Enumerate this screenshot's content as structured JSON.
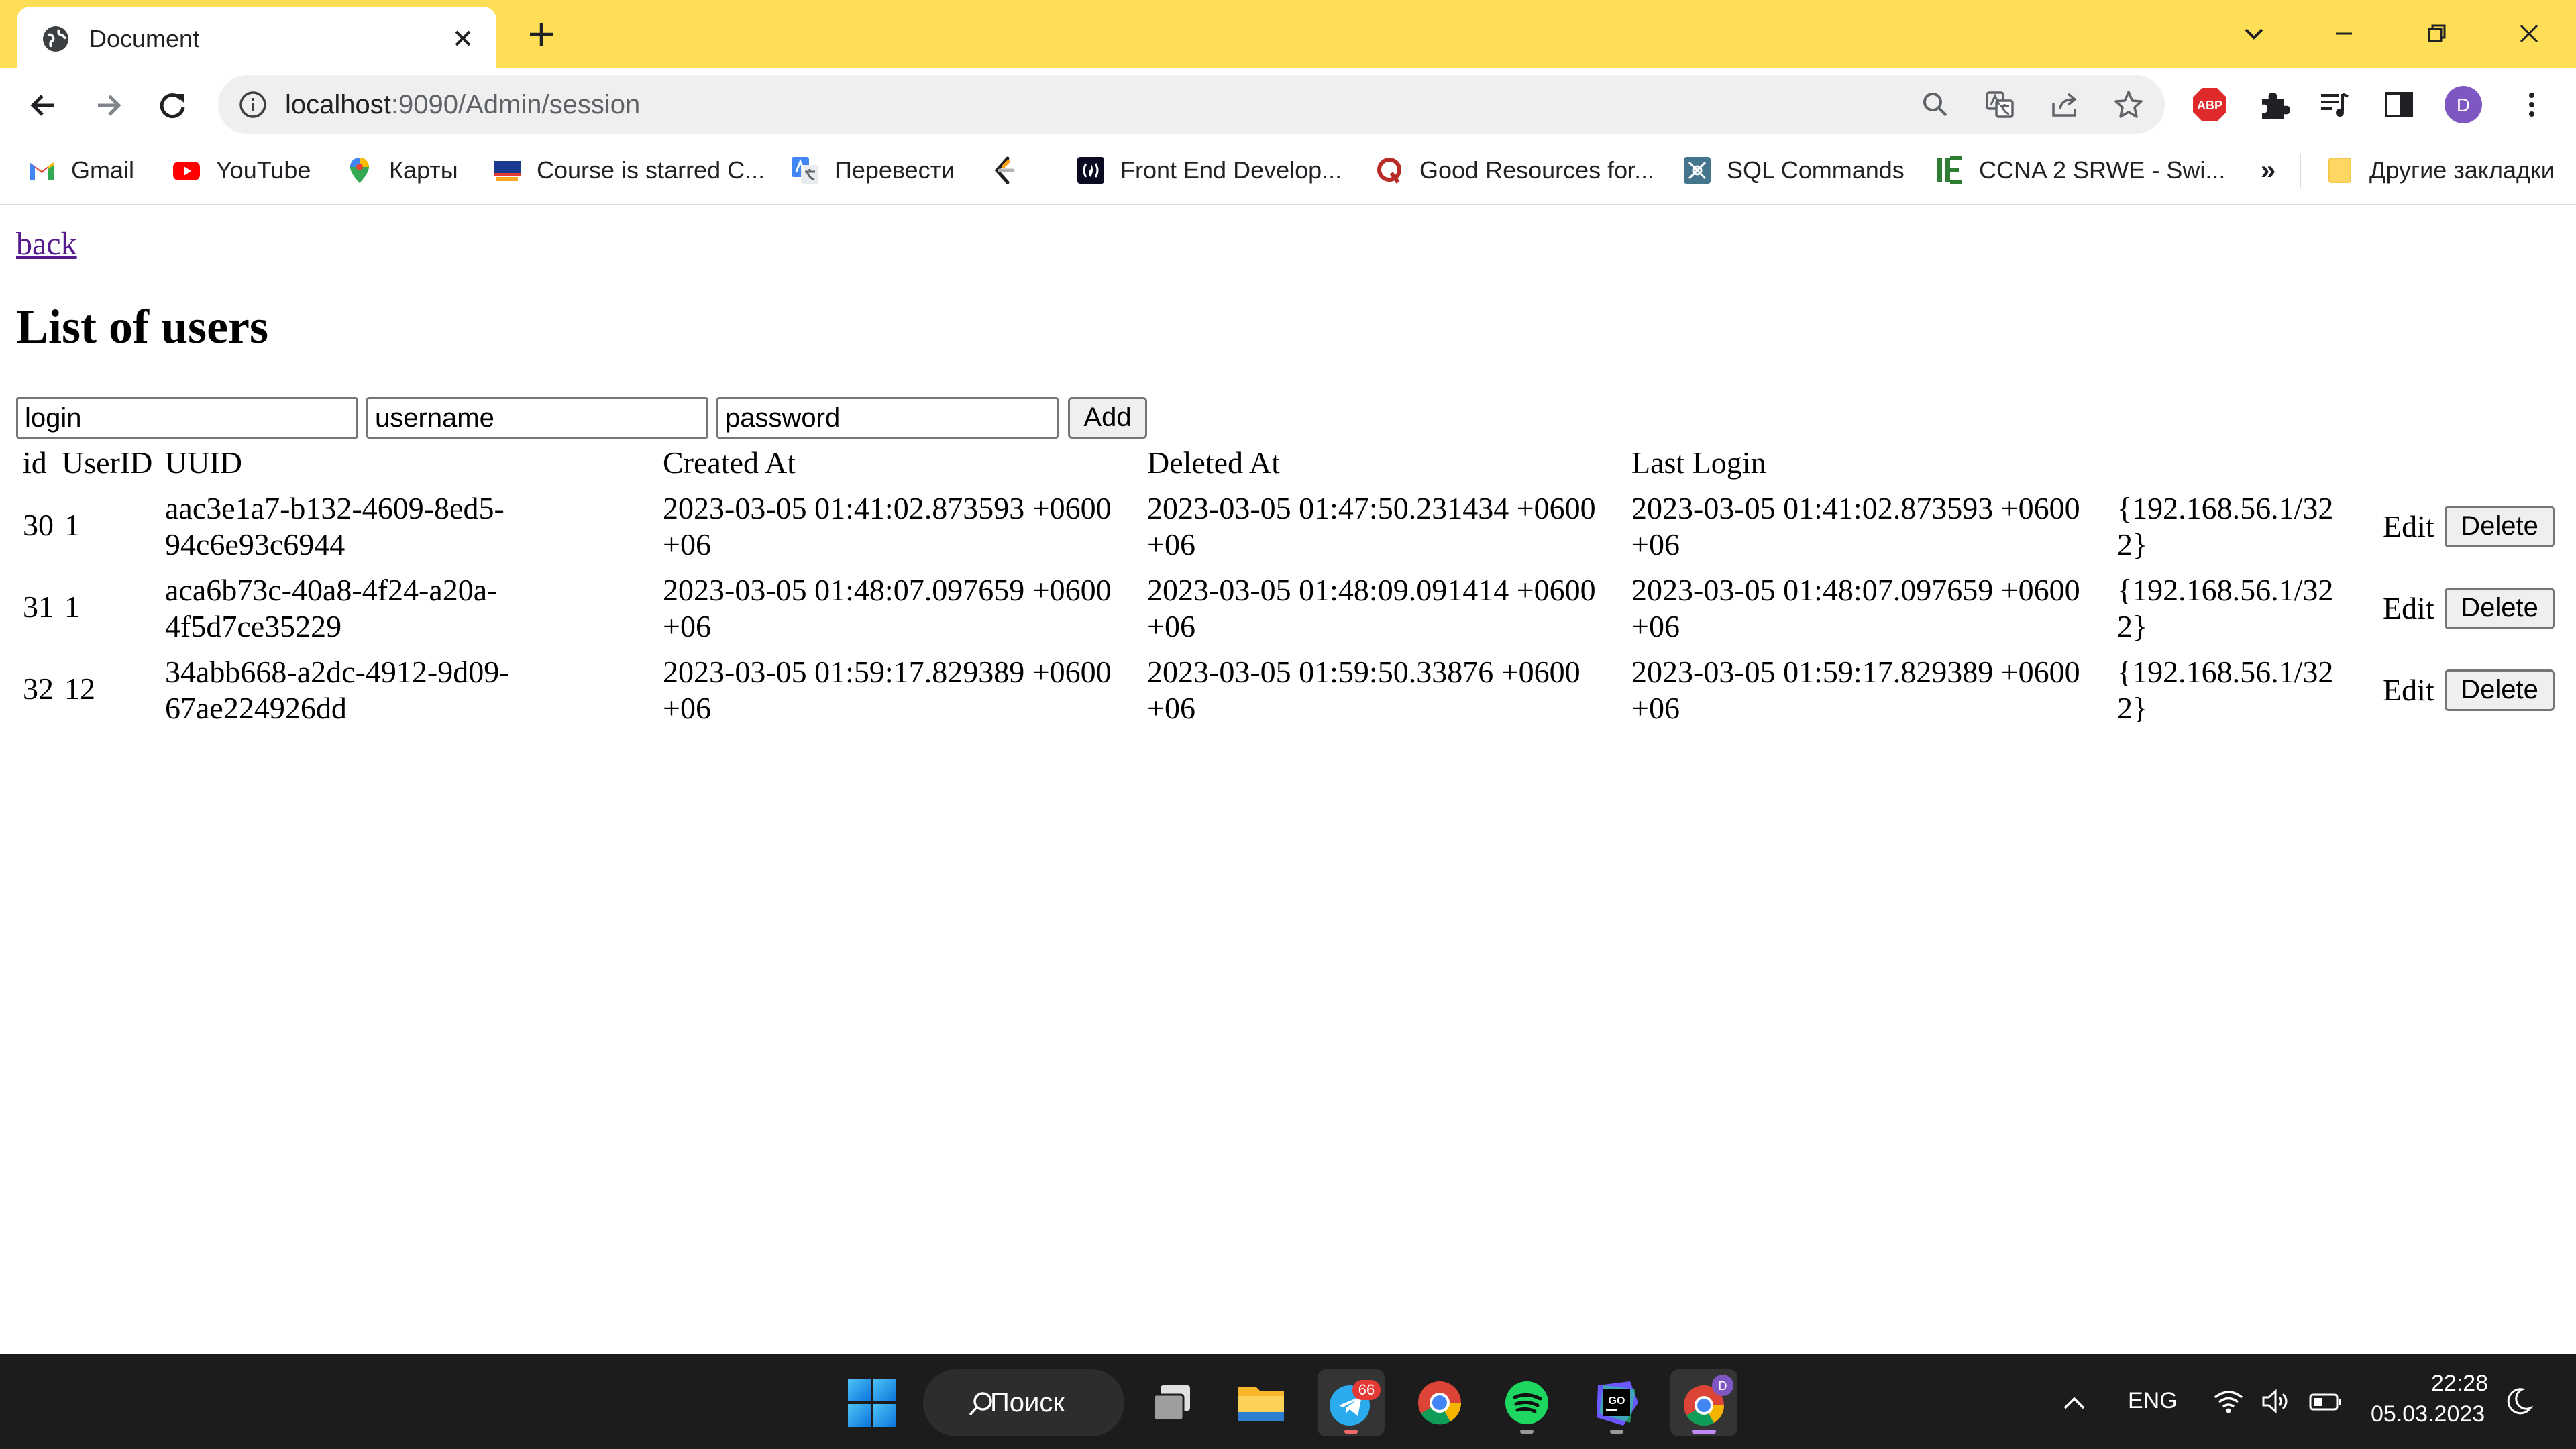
{
  "browser": {
    "tab_title": "Document",
    "url_host": "localhost",
    "url_rest": ":9090/Admin/session",
    "profile_initial": "D",
    "abp_label": "ABP",
    "bookmarks": [
      {
        "label": "Gmail",
        "icon": "gmail-icon"
      },
      {
        "label": "YouTube",
        "icon": "youtube-icon"
      },
      {
        "label": "Карты",
        "icon": "maps-icon"
      },
      {
        "label": "Course is starred C...",
        "icon": "sdu-icon"
      },
      {
        "label": "Перевести",
        "icon": "translate-icon"
      },
      {
        "label": "",
        "icon": "leetcode-icon"
      },
      {
        "label": "Front End Develop...",
        "icon": "frontend-icon"
      },
      {
        "label": "Good Resources for...",
        "icon": "quora-icon"
      },
      {
        "label": "SQL Commands",
        "icon": "sql-icon"
      },
      {
        "label": "CCNA 2 SRWE - Swi...",
        "icon": "ccna-icon"
      }
    ],
    "more_bookmarks": "»",
    "other_bookmarks": "Другие закладки"
  },
  "page": {
    "back_link": "back",
    "title": "List of users",
    "form": {
      "login_placeholder": "login",
      "username_placeholder": "username",
      "password_placeholder": "password",
      "add_label": "Add"
    },
    "table": {
      "headers": [
        "id",
        "UserID",
        "UUID",
        "Created At",
        "Deleted At",
        "Last Login"
      ],
      "rows": [
        {
          "id": "30",
          "user_id": "1",
          "uuid_1": "aac3e1a7-b132-4609-8ed5-",
          "uuid_2": "94c6e93c6944",
          "created_1": "2023-03-05 01:41:02.873593 +0600",
          "created_2": "+06",
          "deleted_1": "2023-03-05 01:47:50.231434 +0600",
          "deleted_2": "+06",
          "login_1": "2023-03-05 01:41:02.873593 +0600",
          "login_2": "+06",
          "ip_1": "{192.168.56.1/32",
          "ip_2": "2}",
          "edit": "Edit",
          "delete": "Delete"
        },
        {
          "id": "31",
          "user_id": "1",
          "uuid_1": "aca6b73c-40a8-4f24-a20a-",
          "uuid_2": "4f5d7ce35229",
          "created_1": "2023-03-05 01:48:07.097659 +0600",
          "created_2": "+06",
          "deleted_1": "2023-03-05 01:48:09.091414 +0600",
          "deleted_2": "+06",
          "login_1": "2023-03-05 01:48:07.097659 +0600",
          "login_2": "+06",
          "ip_1": "{192.168.56.1/32",
          "ip_2": "2}",
          "edit": "Edit",
          "delete": "Delete"
        },
        {
          "id": "32",
          "user_id": "12",
          "uuid_1": "34abb668-a2dc-4912-9d09-",
          "uuid_2": "67ae224926dd",
          "created_1": "2023-03-05 01:59:17.829389 +0600",
          "created_2": "+06",
          "deleted_1": "2023-03-05 01:59:50.33876 +0600",
          "deleted_2": "+06",
          "login_1": "2023-03-05 01:59:17.829389 +0600",
          "login_2": "+06",
          "ip_1": "{192.168.56.1/32",
          "ip_2": "2}",
          "edit": "Edit",
          "delete": "Delete"
        }
      ]
    }
  },
  "taskbar": {
    "search_label": "Поиск",
    "telegram_badge": "66",
    "language": "ENG",
    "time": "22:28",
    "date": "05.03.2023"
  },
  "colors": {
    "tab_strip": "#fede57",
    "visited_link": "#551a8b",
    "taskbar": "#1c1c1c"
  }
}
